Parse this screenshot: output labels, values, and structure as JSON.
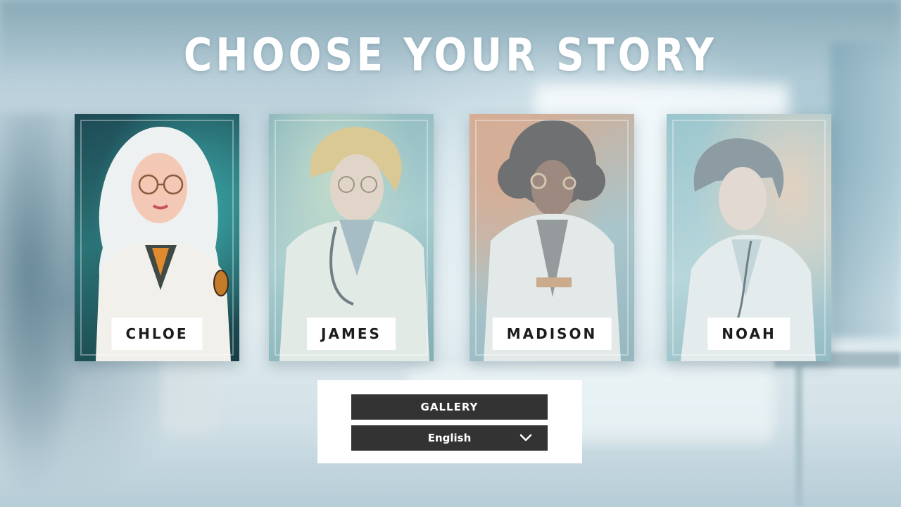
{
  "title": "CHOOSE YOUR STORY",
  "characters": [
    {
      "id": "chloe",
      "name": "CHLOE",
      "selected": true
    },
    {
      "id": "james",
      "name": "JAMES",
      "selected": false
    },
    {
      "id": "madison",
      "name": "MADISON",
      "selected": false
    },
    {
      "id": "noah",
      "name": "NOAH",
      "selected": false
    }
  ],
  "menu": {
    "gallery_label": "GALLERY",
    "language": {
      "selected": "English",
      "icon": "chevron-down-icon"
    }
  },
  "colors": {
    "title": "#ffffff",
    "menu_button_bg": "#333333",
    "menu_button_text": "#ffffff",
    "name_tag_bg": "#ffffff",
    "name_tag_text": "#1c1c1c"
  }
}
